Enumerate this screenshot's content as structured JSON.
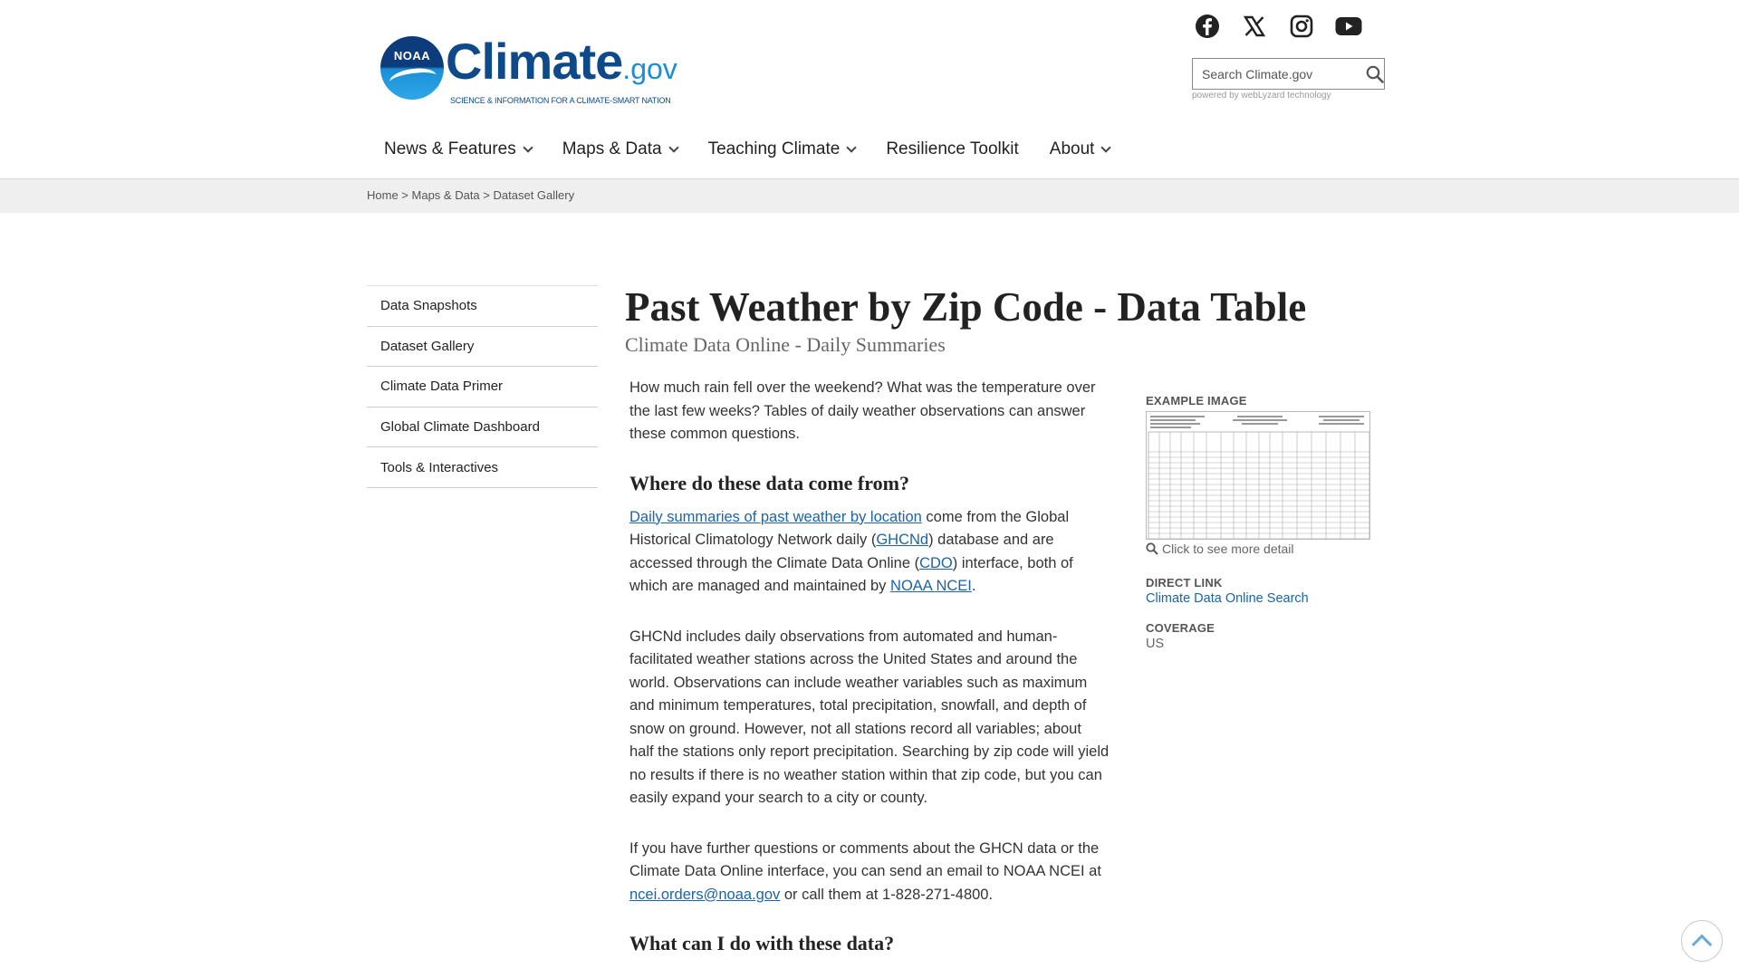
{
  "brand": {
    "badge_text": "NOAA",
    "name": "Climate",
    "suffix": ".gov",
    "tagline": "SCIENCE & INFORMATION FOR A CLIMATE-SMART NATION"
  },
  "social": [
    "facebook-icon",
    "x-icon",
    "instagram-icon",
    "youtube-icon"
  ],
  "search": {
    "placeholder": "Search Climate.gov",
    "value": "",
    "powered_by": "powered by webLyzard technology"
  },
  "nav": {
    "items": [
      {
        "label": "News & Features",
        "has_dropdown": true
      },
      {
        "label": "Maps & Data",
        "has_dropdown": true
      },
      {
        "label": "Teaching Climate",
        "has_dropdown": true
      },
      {
        "label": "Resilience Toolkit",
        "has_dropdown": false
      },
      {
        "label": "About",
        "has_dropdown": true
      }
    ]
  },
  "breadcrumb": {
    "home": "Home",
    "sep1": " > ",
    "section": "Maps & Data",
    "sep2": " > ",
    "page": "Dataset Gallery"
  },
  "sidebar": {
    "items": [
      {
        "label": "Data Snapshots"
      },
      {
        "label": "Dataset Gallery"
      },
      {
        "label": "Climate Data Primer"
      },
      {
        "label": "Global Climate Dashboard"
      },
      {
        "label": "Tools & Interactives"
      }
    ]
  },
  "page": {
    "title": "Past Weather by Zip Code - Data Table",
    "subtitle": "Climate Data Online - Daily Summaries",
    "intro": "How much rain fell over the weekend? What was the temperature over the last few weeks? Tables of daily weather observations can answer these common questions.",
    "h_source": "Where do these data come from?",
    "source_p": {
      "link1": "Daily summaries of past weather by location",
      "t1": " come from the Global Historical Climatology Network daily (",
      "link2": "GHCNd",
      "t2": ") database and are accessed through the Climate Data Online (",
      "link3": "CDO",
      "t3": ") interface, both of which are managed and maintained by ",
      "link4": "NOAA NCEI",
      "t4": "."
    },
    "ghcn_p": "GHCNd includes daily observations from automated and human-facilitated weather stations across the United States and around the world. Observations can include weather variables such as maximum and minimum temperatures, total precipitation, snowfall, and depth of snow on ground. However, not all stations record all variables; about half the stations only report precipitation. Searching by zip code will yield no results if there is no weather station within that zip code, but you can easily expand your search to a city or county.",
    "contact_p": {
      "t1": "If you have further questions or comments about the GHCN data or the Climate Data Online interface, you can send an email to NOAA NCEI at ",
      "email": "ncei.orders@noaa.gov",
      "t2": " or call them at 1-828-271-4800."
    },
    "h_use": "What can I do with these data?"
  },
  "aside": {
    "example_label": "EXAMPLE IMAGE",
    "example_caption": "Click to see more detail",
    "direct_label": "DIRECT LINK",
    "direct_link": "Climate Data Online Search",
    "coverage_label": "COVERAGE",
    "coverage_value": "US"
  },
  "colors": {
    "link": "#1a64a7",
    "brand_dark": "#0e4a8a",
    "brand_light": "#1b8fd6",
    "breadcrumb_bg": "#efefef"
  }
}
